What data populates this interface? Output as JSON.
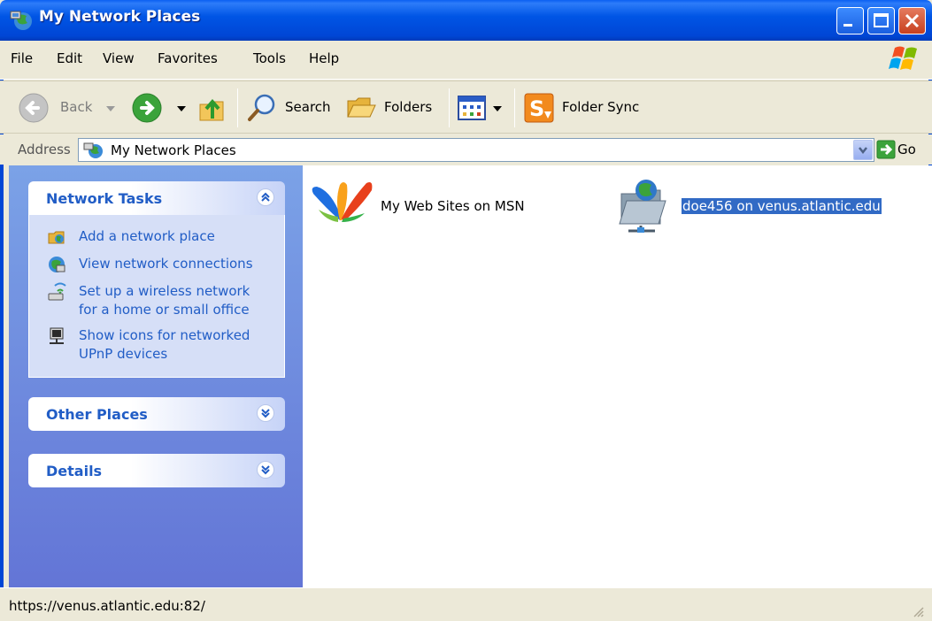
{
  "window": {
    "title": "My Network Places"
  },
  "menu": {
    "items": [
      {
        "label": "File"
      },
      {
        "label": "Edit"
      },
      {
        "label": "View"
      },
      {
        "label": "Favorites"
      },
      {
        "label": "Tools"
      },
      {
        "label": "Help"
      }
    ]
  },
  "toolbar": {
    "back_label": "Back",
    "search_label": "Search",
    "folders_label": "Folders",
    "folder_sync_label": "Folder Sync"
  },
  "address": {
    "label": "Address",
    "value": "My Network Places",
    "go_label": "Go"
  },
  "taskpane": {
    "network_tasks": {
      "title": "Network Tasks",
      "tasks": [
        {
          "label": "Add a network place"
        },
        {
          "label": "View network connections"
        },
        {
          "label": "Set up a wireless network",
          "label2": "for a home or small office"
        },
        {
          "label": "Show icons for networked",
          "label2": "UPnP devices"
        }
      ]
    },
    "other_places": {
      "title": "Other Places"
    },
    "details": {
      "title": "Details"
    }
  },
  "content": {
    "items": [
      {
        "label": "My Web Sites on MSN",
        "icon": "msn-butterfly-icon",
        "selected": false
      },
      {
        "label": "doe456 on venus.atlantic.edu",
        "icon": "network-folder-icon",
        "selected": true
      }
    ]
  },
  "status": {
    "text": "https://venus.atlantic.edu:82/"
  },
  "colors": {
    "title_bar": "#0055E5",
    "task_link": "#215DC6",
    "selection": "#316AC5",
    "close_button": "#C8401F"
  }
}
